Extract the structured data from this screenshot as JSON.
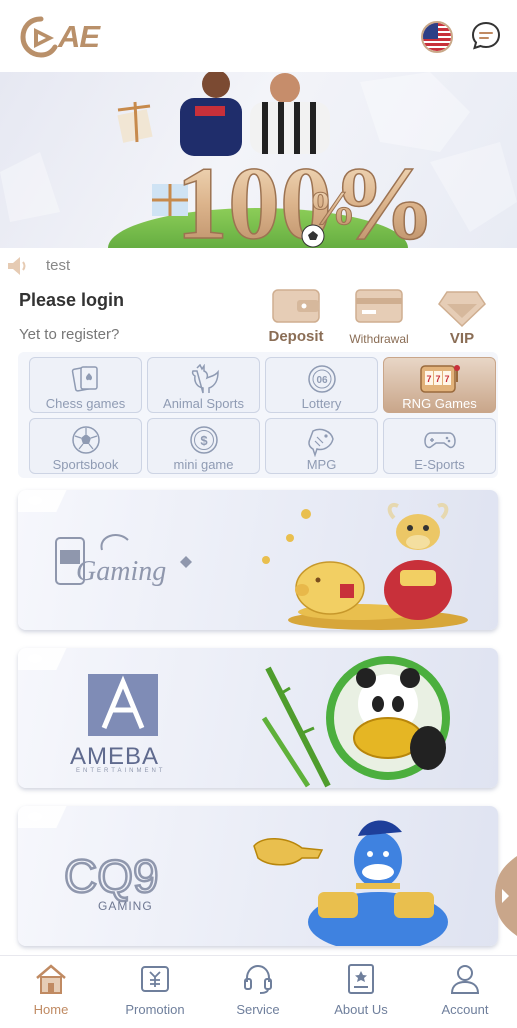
{
  "brand": {
    "logo_text": "AE",
    "accent": "#b9906a"
  },
  "header": {
    "flag_icon": "us-flag-icon",
    "chat_icon": "chat-icon"
  },
  "banner": {
    "promo_text": "100%",
    "percent": "%"
  },
  "notice": {
    "icon": "speaker-icon",
    "text": "test"
  },
  "login": {
    "title": "Please login",
    "register": "Yet to register?"
  },
  "quick_actions": [
    {
      "label": "Deposit",
      "icon": "wallet-icon"
    },
    {
      "label": "Withdrawal",
      "icon": "card-icon"
    },
    {
      "label": "VIP",
      "icon": "diamond-icon"
    }
  ],
  "categories": [
    {
      "label": "Chess games",
      "icon": "cards-icon"
    },
    {
      "label": "Animal Sports",
      "icon": "rooster-icon"
    },
    {
      "label": "Lottery",
      "icon": "lottery-ball-icon"
    },
    {
      "label": "RNG Games",
      "icon": "slot-machine-icon",
      "active": true
    },
    {
      "label": "Sportsbook",
      "icon": "soccer-ball-icon"
    },
    {
      "label": "mini game",
      "icon": "coin-icon"
    },
    {
      "label": "MPG",
      "icon": "fish-icon"
    },
    {
      "label": "E-Sports",
      "icon": "gamepad-icon"
    }
  ],
  "providers": [
    {
      "name": "Gaming",
      "logo_text": "Gaming"
    },
    {
      "name": "AMEBA",
      "logo_text": "AMEBA",
      "sub_text": "ENTERTAINMENT"
    },
    {
      "name": "CQ9",
      "logo_text": "CQ9",
      "sub_text": "GAMING"
    }
  ],
  "tabbar": [
    {
      "label": "Home",
      "icon": "home-icon",
      "active": true
    },
    {
      "label": "Promotion",
      "icon": "promotion-icon"
    },
    {
      "label": "Service",
      "icon": "headset-icon"
    },
    {
      "label": "About Us",
      "icon": "about-icon"
    },
    {
      "label": "Account",
      "icon": "user-icon"
    }
  ],
  "colors": {
    "active_tab": "#c08a62",
    "inactive_tab": "#6f7f9c",
    "category_text": "#8f9bb3"
  }
}
